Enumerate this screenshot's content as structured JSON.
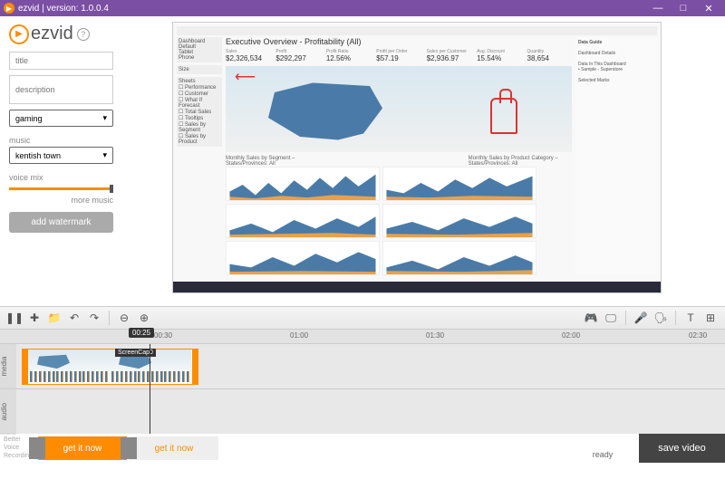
{
  "titlebar": {
    "app": "ezvid",
    "version": "version: 1.0.0.4"
  },
  "logo": {
    "text": "ezvid"
  },
  "fields": {
    "title_ph": "title",
    "desc_ph": "description",
    "category": "gaming"
  },
  "music": {
    "label": "music",
    "track": "kentish town"
  },
  "voice": {
    "label": "voice mix",
    "more": "more music"
  },
  "watermark": "add watermark",
  "preview": {
    "title": "Executive Overview - Profitability (All)",
    "kpis": [
      {
        "l": "Sales",
        "v": "$2,326,534"
      },
      {
        "l": "Profit",
        "v": "$292,297"
      },
      {
        "l": "Profit Ratio",
        "v": "12.56%"
      },
      {
        "l": "Profit per Order",
        "v": "$57.19"
      },
      {
        "l": "Sales per Customer",
        "v": "$2,936.97"
      },
      {
        "l": "Avg. Discount",
        "v": "15.54%"
      },
      {
        "l": "Quantity",
        "v": "38,654"
      }
    ],
    "right_title": "Data Guide",
    "chart1": "Monthly Sales by Segment – States/Provinces: All",
    "chart2": "Monthly Sales by Product Category – States/Provinces: All"
  },
  "ruler": {
    "t0": "00:30",
    "t1": "01:00",
    "t2": "01:30",
    "t3": "02:00",
    "t4": "02:30"
  },
  "playhead": "00:25",
  "clip_label": "ScreenCap0",
  "tracks": {
    "media": "media",
    "audio": "audio"
  },
  "footer": {
    "hint": "Better\nVoice\nRecording",
    "promo": "get it now",
    "status": "ready",
    "save": "save video"
  }
}
